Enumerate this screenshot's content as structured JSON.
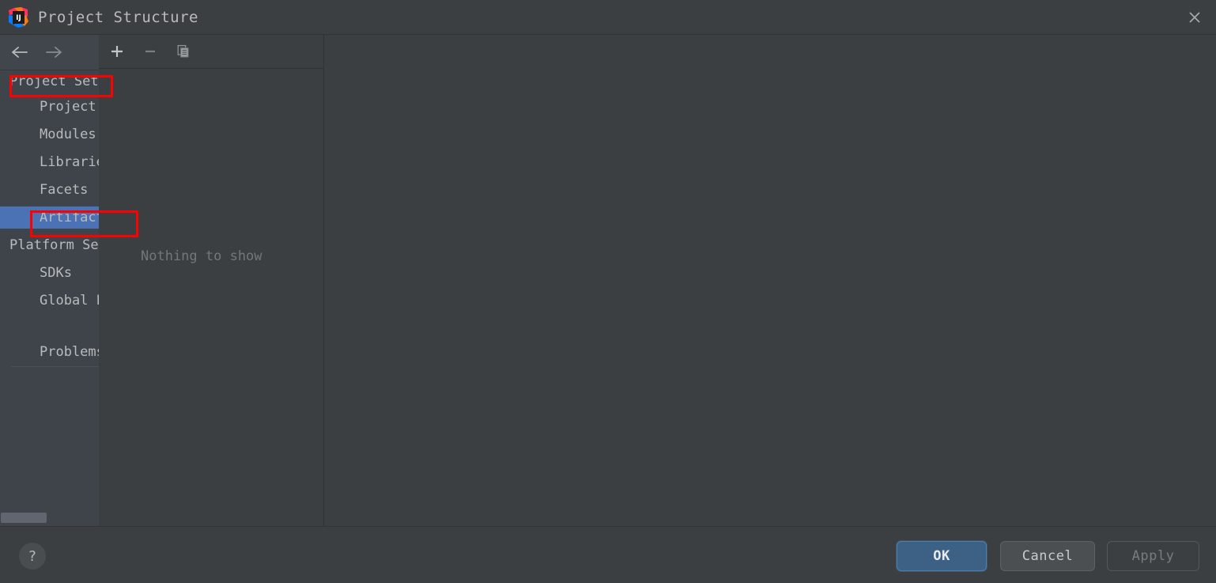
{
  "window": {
    "title": "Project Structure",
    "logo_icon": "intellij-idea-logo",
    "close_icon": "close-icon"
  },
  "sidebar": {
    "nav": {
      "back_icon": "arrow-left-icon",
      "forward_icon": "arrow-right-icon"
    },
    "items": [
      {
        "label": "Project Settings",
        "type": "group",
        "selected": false
      },
      {
        "label": "Project",
        "type": "child",
        "selected": false
      },
      {
        "label": "Modules",
        "type": "child",
        "selected": false
      },
      {
        "label": "Libraries",
        "type": "child",
        "selected": false
      },
      {
        "label": "Facets",
        "type": "child",
        "selected": false
      },
      {
        "label": "Artifacts",
        "type": "child",
        "selected": true
      },
      {
        "label": "Platform Settings",
        "type": "group",
        "selected": false
      },
      {
        "label": "SDKs",
        "type": "child",
        "selected": false
      },
      {
        "label": "Global Libraries",
        "type": "child",
        "selected": false
      },
      {
        "label": "Problems",
        "type": "child",
        "selected": false
      }
    ],
    "scrollbar": {
      "orientation": "horizontal"
    }
  },
  "middle_panel": {
    "toolbar": {
      "add_icon": "plus-icon",
      "remove_icon": "minus-icon",
      "copy_icon": "copy-icon"
    },
    "empty_message": "Nothing to show"
  },
  "footer": {
    "help_label": "?",
    "ok_label": "OK",
    "cancel_label": "Cancel",
    "apply_label": "Apply"
  },
  "colors": {
    "selection_blue": "#4b72b5",
    "annotation_red": "#ff0000",
    "ok_button_blue": "#3d6185",
    "panel_bg": "#3c3f41",
    "sidebar_bg": "#3f434a"
  }
}
